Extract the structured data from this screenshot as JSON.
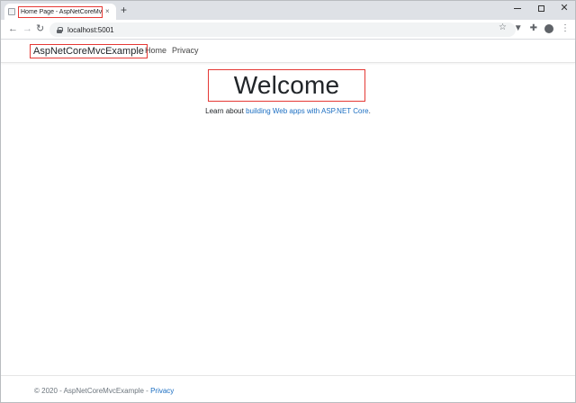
{
  "browser": {
    "tab_title": "Home Page - AspNetCoreMvcExample",
    "tab_close": "×",
    "new_tab": "+",
    "url": "localhost:5001",
    "icons": {
      "back": "back-arrow-icon",
      "forward": "forward-arrow-icon",
      "reload": "reload-icon",
      "star": "star-icon",
      "extension": "extension-puzzle-icon",
      "profile": "profile-icon",
      "menu": "kebab-menu-icon"
    }
  },
  "site": {
    "brand": "AspNetCoreMvcExample",
    "nav": [
      {
        "label": "Home"
      },
      {
        "label": "Privacy"
      }
    ],
    "heading": "Welcome",
    "learn_prefix": "Learn about ",
    "learn_link": "building Web apps with ASP.NET Core",
    "learn_suffix": ".",
    "footer_text": "© 2020 - AspNetCoreMvcExample - ",
    "footer_link": "Privacy"
  },
  "colors": {
    "highlight_box": "#e53935",
    "link": "#1b6ec2",
    "chrome_bg": "#dee1e6"
  }
}
